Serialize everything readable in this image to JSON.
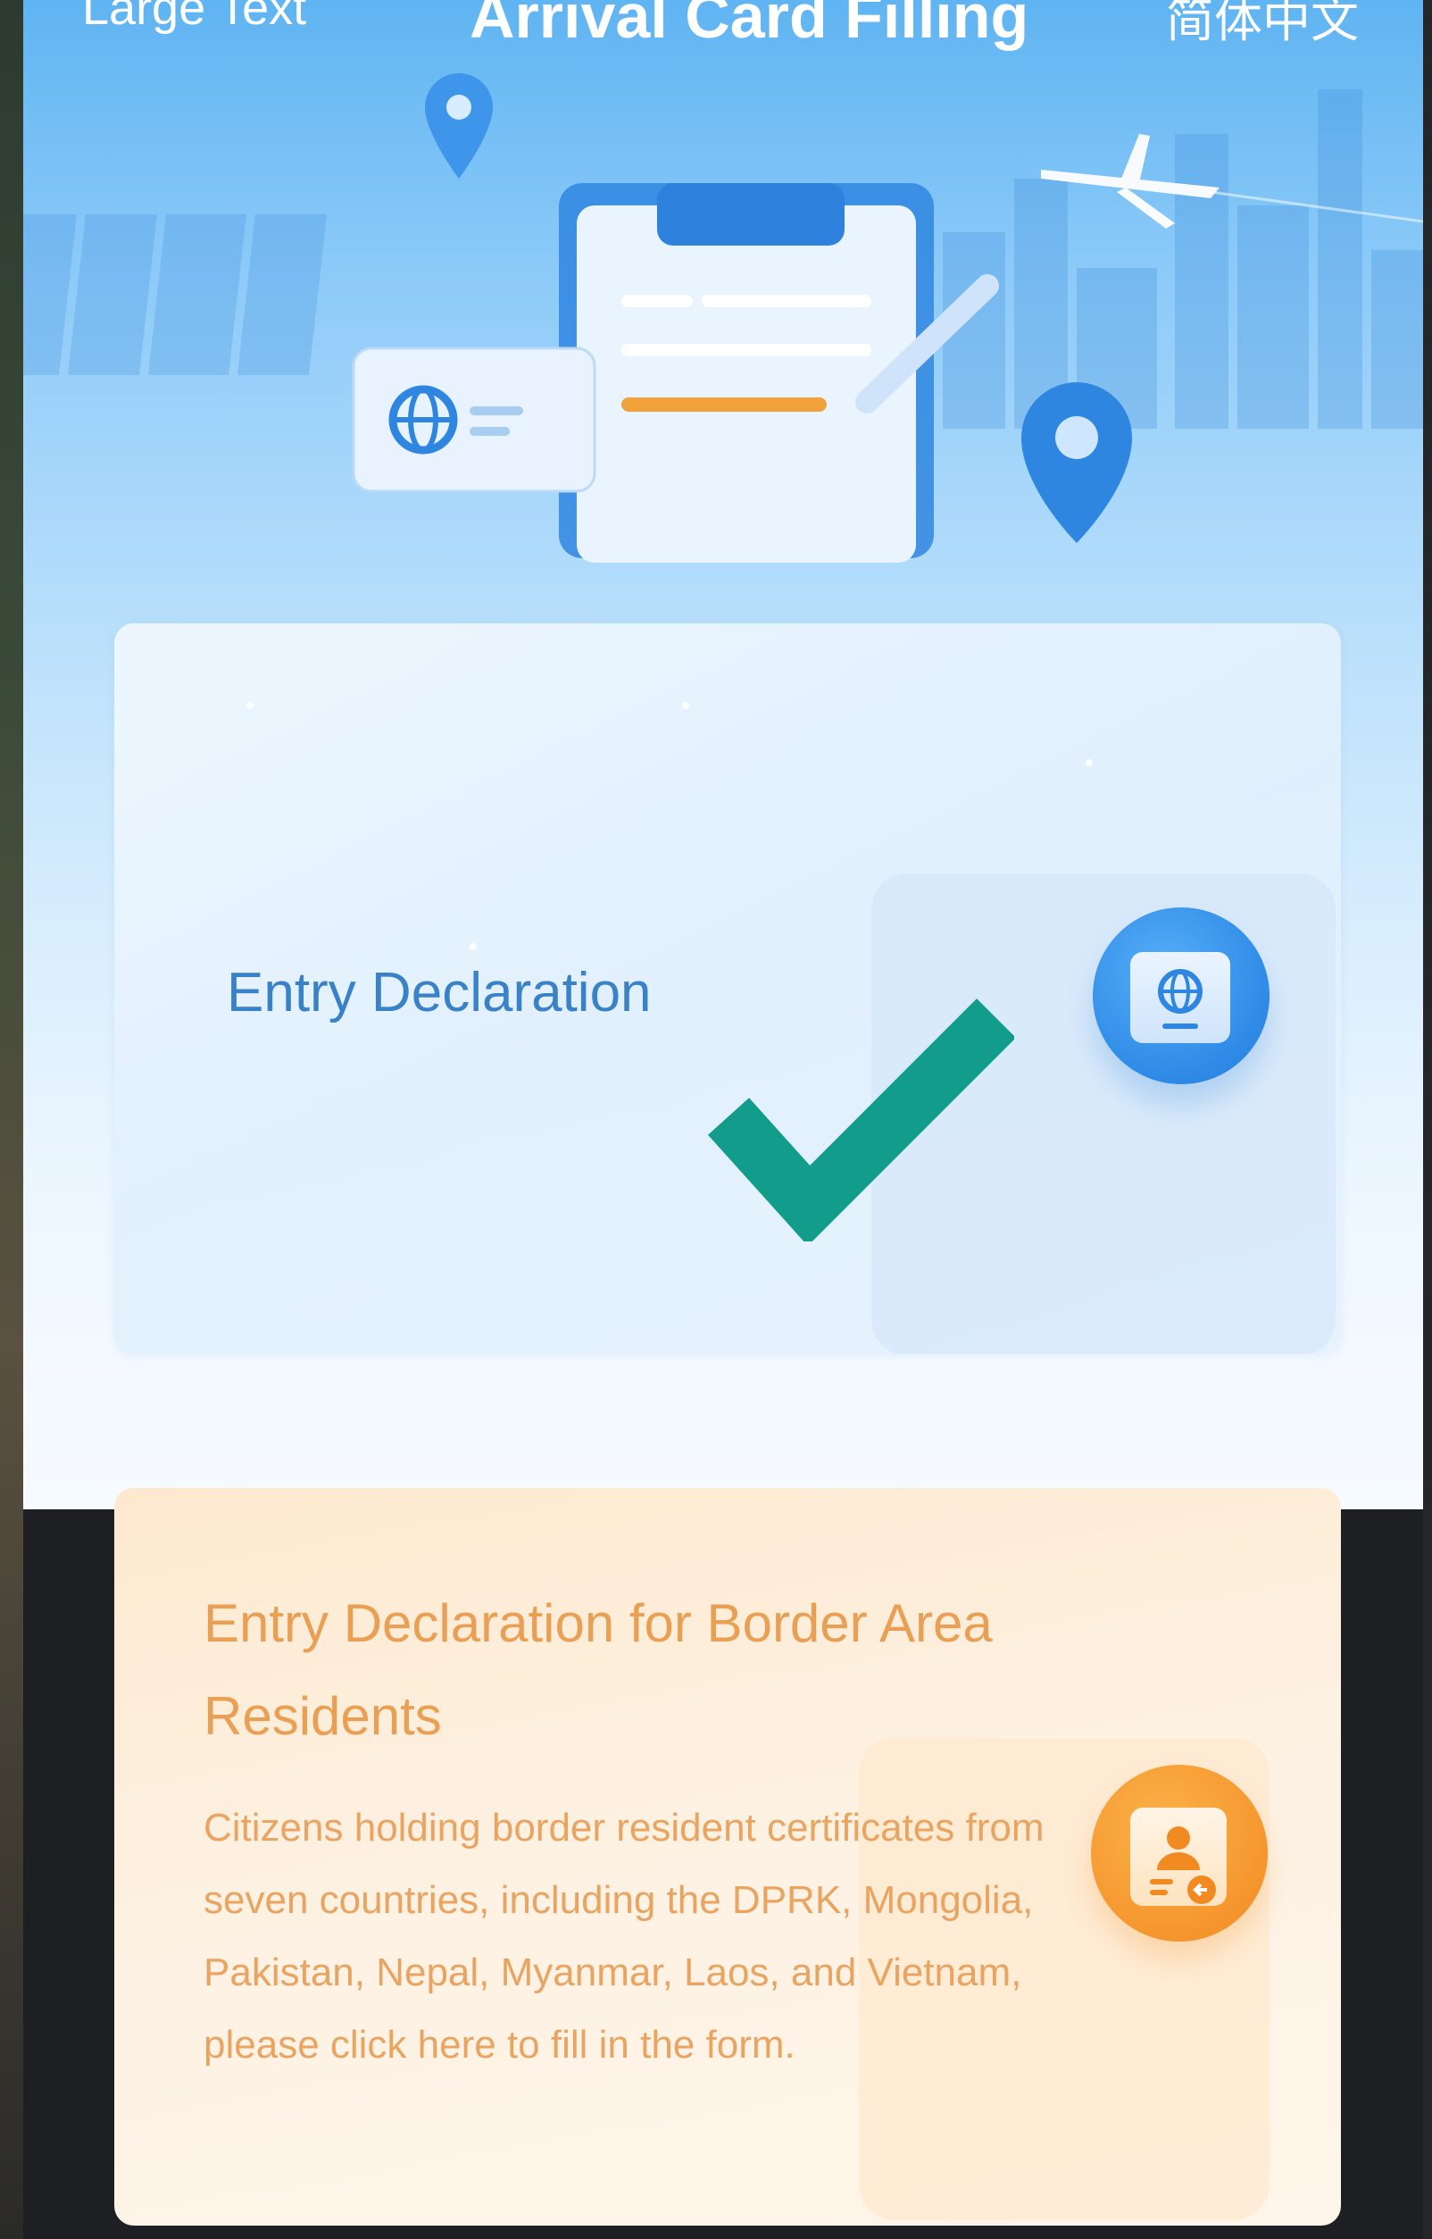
{
  "header": {
    "large_text_label": "Large Text",
    "title": "Arrival Card Filling",
    "language_label": "简体中文"
  },
  "cards": {
    "entry": {
      "title": "Entry Declaration",
      "icon": "passport-globe-icon",
      "status_mark": "checkmark-icon",
      "accent": "#2e8ae6"
    },
    "border_residents": {
      "title": "Entry Declaration for Border Area Residents",
      "description": "Citizens holding border resident certificates from seven countries, including the DPRK, Mongolia, Pakistan, Nepal, Myanmar, Laos, and Vietnam, please click here to fill in the form.",
      "icon": "resident-certificate-icon",
      "accent": "#f5962d"
    }
  },
  "colors": {
    "check": "#129c8c",
    "entry_title": "#3a82c8",
    "border_title": "#e9a054"
  }
}
